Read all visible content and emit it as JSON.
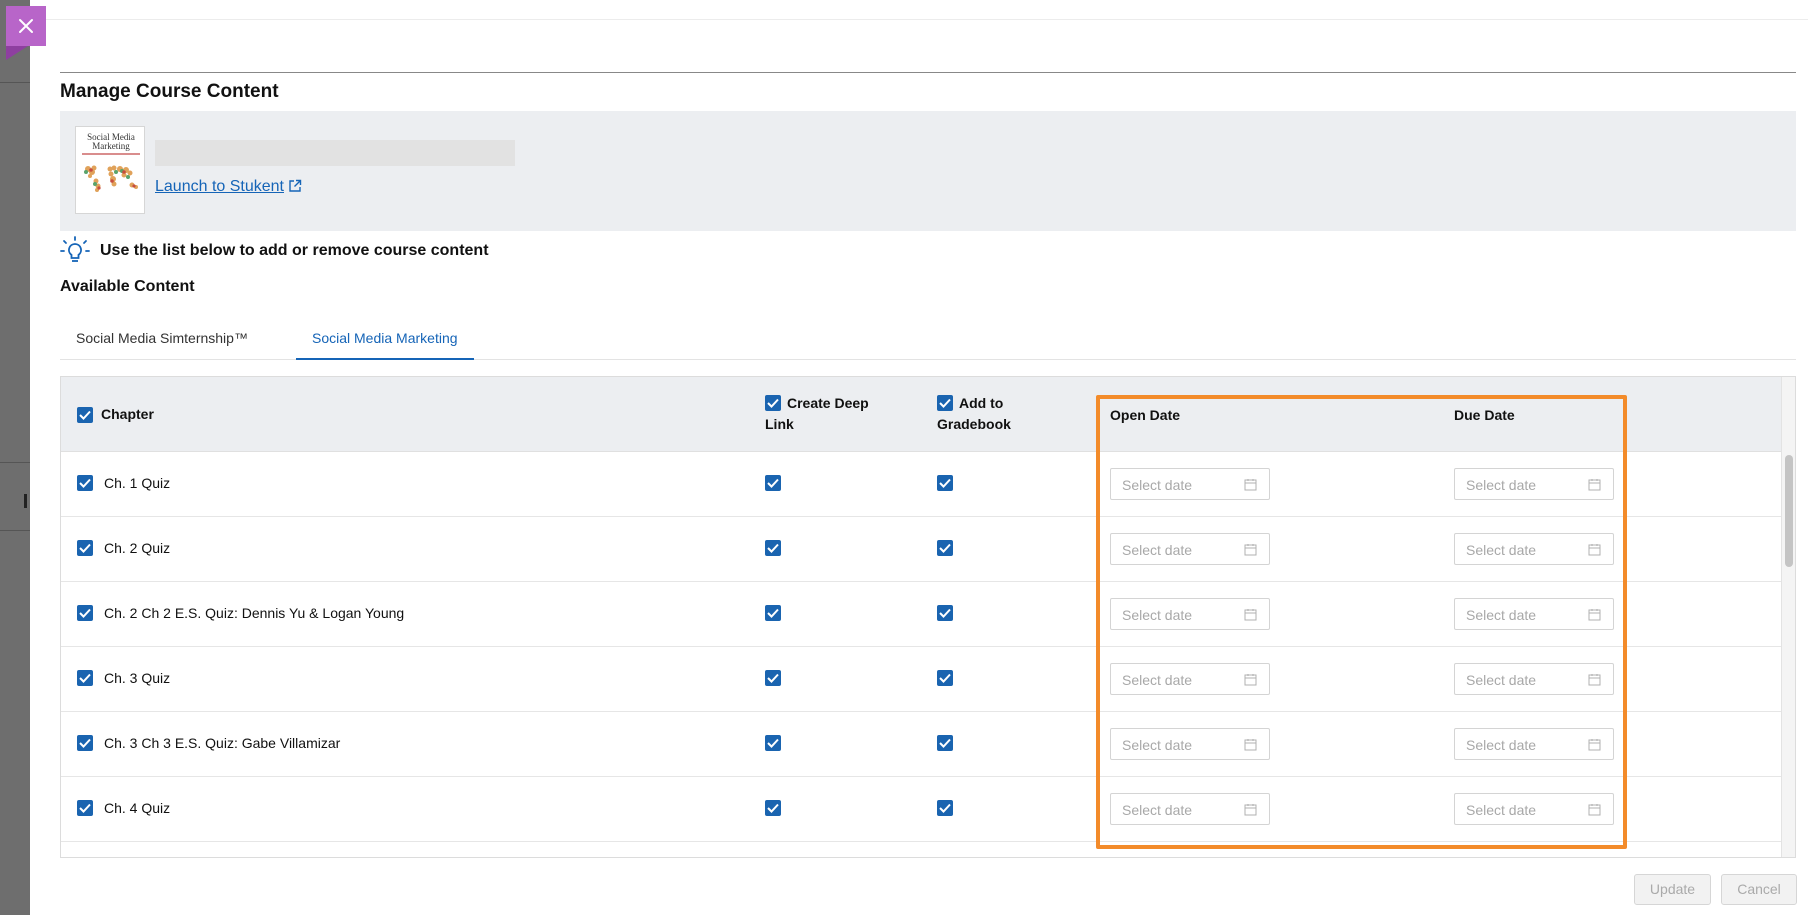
{
  "window": {
    "close_icon": "close-icon",
    "accent_color": "#b865c9"
  },
  "page": {
    "title": "Manage Course Content"
  },
  "course": {
    "thumbnail_title": "Social Media Marketing",
    "launch_link": "Launch to Stukent",
    "launch_icon": "external-link-icon"
  },
  "tip": {
    "icon": "lightbulb-icon",
    "text": "Use the list below to add or remove course content"
  },
  "available_label": "Available Content",
  "tabs": [
    {
      "label": "Social Media Simternship™",
      "active": false
    },
    {
      "label": "Social Media Marketing",
      "active": true
    }
  ],
  "table": {
    "headers": {
      "chapter": "Chapter",
      "deep_link": "Create Deep Link",
      "gradebook": "Add to Gradebook",
      "open_date": "Open Date",
      "due_date": "Due Date"
    },
    "date_placeholder": "Select date",
    "rows": [
      {
        "chapter": "Ch. 1 Quiz",
        "selected": true,
        "deep_link": true,
        "gradebook": true
      },
      {
        "chapter": "Ch. 2 Quiz",
        "selected": true,
        "deep_link": true,
        "gradebook": true
      },
      {
        "chapter": "Ch. 2 Ch 2 E.S. Quiz: Dennis Yu & Logan Young",
        "selected": true,
        "deep_link": true,
        "gradebook": true
      },
      {
        "chapter": "Ch. 3 Quiz",
        "selected": true,
        "deep_link": true,
        "gradebook": true
      },
      {
        "chapter": "Ch. 3 Ch 3 E.S. Quiz: Gabe Villamizar",
        "selected": true,
        "deep_link": true,
        "gradebook": true
      },
      {
        "chapter": "Ch. 4 Quiz",
        "selected": true,
        "deep_link": true,
        "gradebook": true
      }
    ]
  },
  "footer": {
    "update": "Update",
    "cancel": "Cancel"
  },
  "colors": {
    "primary": "#1564b7",
    "checkbox": "#1a64b0",
    "highlight": "#f38b2a",
    "header_bg": "#eceef1"
  }
}
